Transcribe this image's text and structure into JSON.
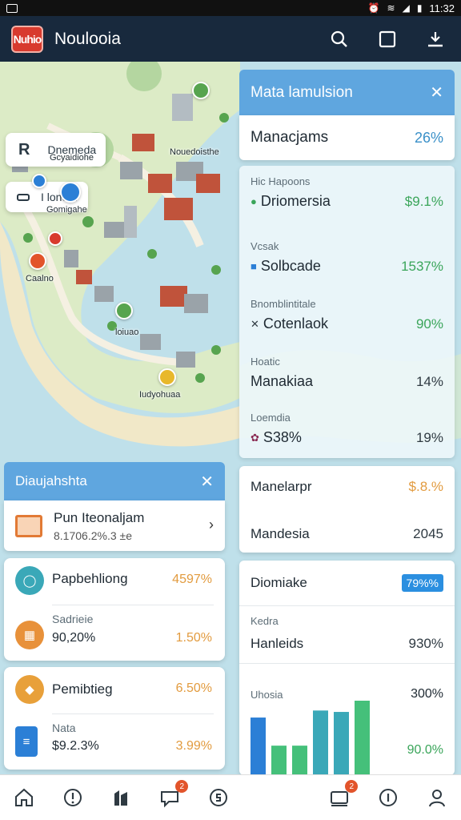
{
  "status_bar": {
    "time": "11:32"
  },
  "app_bar": {
    "logo_text": "Nuhio",
    "title": "Noulooia"
  },
  "map": {
    "chip_1": {
      "icon_text": "R",
      "label": "Dnemeda"
    },
    "chip_2": {
      "label": "I lonom"
    },
    "pins": [
      {
        "label": "Gcyaidiohe"
      },
      {
        "label": "Nouedoisthe"
      },
      {
        "label": "Gomigahe"
      },
      {
        "label": "Caalno"
      },
      {
        "label": "loiuao"
      },
      {
        "label": "Iudyohuaa"
      }
    ]
  },
  "right_panel": {
    "title": "Mata lamulsion",
    "top_row": {
      "label": "Manacjams",
      "value": "26%"
    },
    "rows": [
      {
        "caption": "Hic Hapoons",
        "name": "Driomersia",
        "value": "$9.1%"
      },
      {
        "caption": "Vcsak",
        "name": "Solbcade",
        "value": "1537%"
      },
      {
        "caption": "Bnomblintitale",
        "name": "Cotenlaok",
        "value": "90%"
      },
      {
        "caption": "Hoatic",
        "name": "Manakiaa",
        "value": "14%"
      },
      {
        "caption": "Loemdia",
        "name": "S38%",
        "value": "19%"
      }
    ]
  },
  "left_panel": {
    "title": "Diaujahshta",
    "sub": {
      "title": "Pun Iteonaljam",
      "meta": "8.1706.2%.3 ±e"
    },
    "card_a": {
      "title": "Papbehliong",
      "title_value": "4597%",
      "sub_label": "Sadrieie",
      "sub_value": "90,20%",
      "sub_pct": "1.50%"
    },
    "card_b": {
      "title": "Pemibtieg",
      "title_value": "6.50%",
      "sub_label": "Nata",
      "sub_value": "$9.2.3%",
      "sub_pct": "3.99%"
    }
  },
  "right_card_1": {
    "row_1": {
      "label": "Manelarpr",
      "value": "$.8.%"
    },
    "row_2": {
      "label": "Mandesia",
      "value": "2045"
    }
  },
  "right_card_2": {
    "header": "Diomiake",
    "badge": "79%%",
    "caption": "Kedra",
    "sub_label": "Hanleids",
    "sub_value": "930%",
    "chart_caption": "Uhosia",
    "value_1": "300%",
    "value_2": "90.0%"
  },
  "chart_data": {
    "type": "bar",
    "values": [
      82,
      42,
      42,
      92,
      90,
      106
    ],
    "colors": [
      "#2b7fd6",
      "#45c07a",
      "#45c07a",
      "#3aa8b8",
      "#3aa8b8",
      "#45c07a"
    ]
  },
  "bottom_nav": {
    "badges": [
      "2",
      "2"
    ]
  }
}
